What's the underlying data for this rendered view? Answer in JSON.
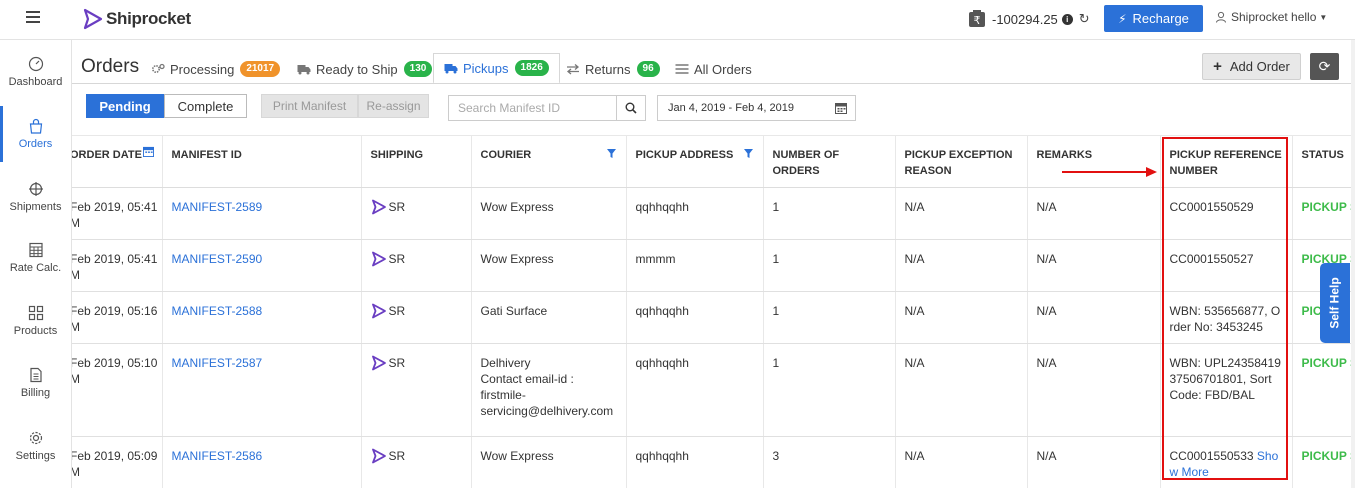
{
  "header": {
    "logo_text": "Shiprocket",
    "wallet_balance": "-100294.25",
    "recharge_label": "Recharge",
    "user_name": "Shiprocket hello"
  },
  "sidebar": {
    "items": [
      {
        "label": "Dashboard",
        "icon": "speedometer-icon"
      },
      {
        "label": "Orders",
        "icon": "shopping-bag-icon"
      },
      {
        "label": "Shipments",
        "icon": "crosshair-icon"
      },
      {
        "label": "Rate Calc.",
        "icon": "calculator-icon"
      },
      {
        "label": "Products",
        "icon": "grid-icon"
      },
      {
        "label": "Billing",
        "icon": "document-icon"
      },
      {
        "label": "Settings",
        "icon": "gear-icon"
      }
    ],
    "active": "Orders"
  },
  "page": {
    "title": "Orders",
    "tabs": [
      {
        "label": "Processing",
        "count": "21017",
        "badge_color": "#f0932b"
      },
      {
        "label": "Ready to Ship",
        "count": "130",
        "badge_color": "#29b34a"
      },
      {
        "label": "Pickups",
        "count": "1826",
        "badge_color": "#29b34a"
      },
      {
        "label": "Returns",
        "count": "96",
        "badge_color": "#29b34a"
      },
      {
        "label": "All Orders",
        "count": ""
      }
    ],
    "active_tab": "Pickups",
    "add_order_label": "Add Order"
  },
  "filters": {
    "pending_label": "Pending",
    "complete_label": "Complete",
    "print_manifest_label": "Print Manifest",
    "reassign_label": "Re-assign",
    "search_placeholder": "Search Manifest ID",
    "date_range": "Jan 4, 2019 - Feb 4, 2019"
  },
  "table": {
    "columns": [
      "ORDER DATE",
      "MANIFEST ID",
      "SHIPPING",
      "COURIER",
      "PICKUP ADDRESS",
      "NUMBER OF ORDERS",
      "PICKUP EXCEPTION REASON",
      "REMARKS",
      "PICKUP REFERENCE NUMBER",
      "STATUS"
    ],
    "rows": [
      {
        "date": "Feb 2019, 05:41",
        "date2": "M",
        "manifest": "MANIFEST-2589",
        "shipping": "SR",
        "courier": [
          "Wow Express"
        ],
        "address": "qqhhqqhh",
        "orders": "1",
        "exception": "N/A",
        "remarks": "N/A",
        "ref": "CC0001550529",
        "ref_more": "",
        "status": "PICKUP S"
      },
      {
        "date": "Feb 2019, 05:41",
        "date2": "M",
        "manifest": "MANIFEST-2590",
        "shipping": "SR",
        "courier": [
          "Wow Express"
        ],
        "address": "mmmm",
        "orders": "1",
        "exception": "N/A",
        "remarks": "N/A",
        "ref": "CC0001550527",
        "ref_more": "",
        "status": "PICKUP S"
      },
      {
        "date": "Feb 2019, 05:16",
        "date2": "M",
        "manifest": "MANIFEST-2588",
        "shipping": "SR",
        "courier": [
          "Gati Surface"
        ],
        "address": "qqhhqqhh",
        "orders": "1",
        "exception": "N/A",
        "remarks": "N/A",
        "ref": "WBN: 535656877, Order No: 3453245",
        "ref_more": "",
        "status": "PIC"
      },
      {
        "date": "Feb 2019, 05:10",
        "date2": "M",
        "manifest": "MANIFEST-2587",
        "shipping": "SR",
        "courier": [
          "Delhivery",
          "Contact email-id :",
          "firstmile-",
          "servicing@delhivery.com"
        ],
        "address": "qqhhqqhh",
        "orders": "1",
        "exception": "N/A",
        "remarks": "N/A",
        "ref": "WBN: UPL2435841937506701801, Sort Code: FBD/BAL",
        "ref_more": "",
        "status": "PICKUP S"
      },
      {
        "date": "Feb 2019, 05:09",
        "date2": "M",
        "manifest": "MANIFEST-2586",
        "shipping": "SR",
        "courier": [
          "Wow Express"
        ],
        "address": "qqhhqqhh",
        "orders": "3",
        "exception": "N/A",
        "remarks": "N/A",
        "ref": "CC0001550533",
        "ref_more": "Show More",
        "status": "PICKUP S"
      }
    ]
  },
  "self_help_label": "Self Help",
  "colors": {
    "brand_blue": "#2b71d8",
    "status_green": "#3dbb4a",
    "highlight_red": "#e21010"
  }
}
